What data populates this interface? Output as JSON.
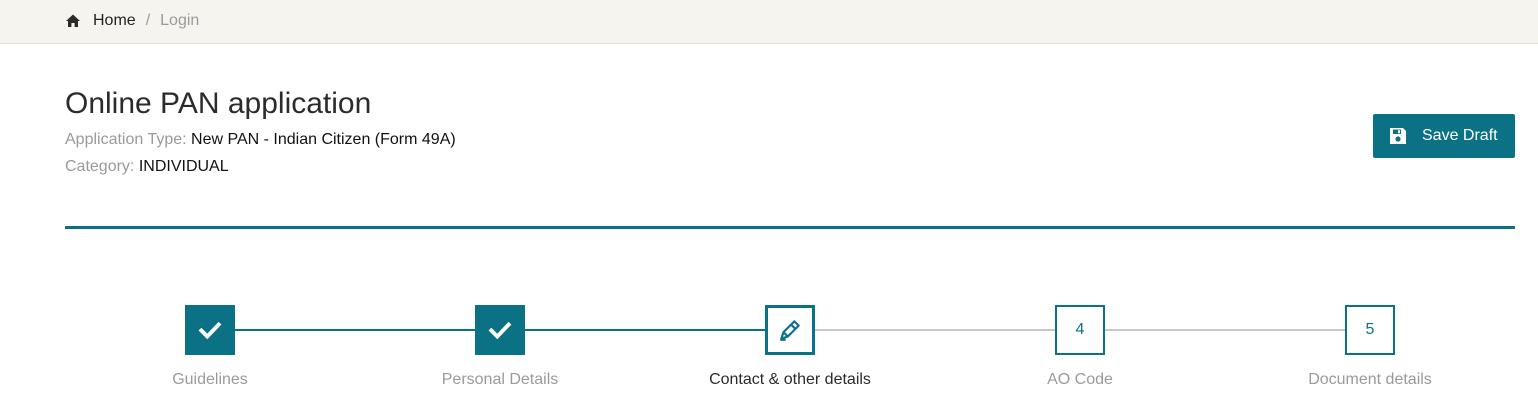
{
  "breadcrumb": {
    "home": "Home",
    "separator": "/",
    "current": "Login"
  },
  "page": {
    "title": "Online PAN application",
    "application_type_key": "Application Type:",
    "application_type_value": "New PAN - Indian Citizen (Form 49A)",
    "category_key": "Category:",
    "category_value": "INDIVIDUAL"
  },
  "toolbar": {
    "save_label": "Save Draft",
    "save_icon": "floppy-disk-icon"
  },
  "colors": {
    "accent": "#0b7285",
    "breadcrumb_bg": "#f5f4ee",
    "muted_text": "#9a9a9a",
    "pending_line": "#c8c8c8"
  },
  "steps": [
    {
      "label": "Guidelines",
      "status": "completed",
      "icon": "check-icon"
    },
    {
      "label": "Personal Details",
      "status": "completed",
      "icon": "check-icon"
    },
    {
      "label": "Contact & other details",
      "status": "current",
      "icon": "pencil-icon"
    },
    {
      "label": "AO Code",
      "status": "pending",
      "number": "4"
    },
    {
      "label": "Document details",
      "status": "pending",
      "number": "5"
    }
  ]
}
